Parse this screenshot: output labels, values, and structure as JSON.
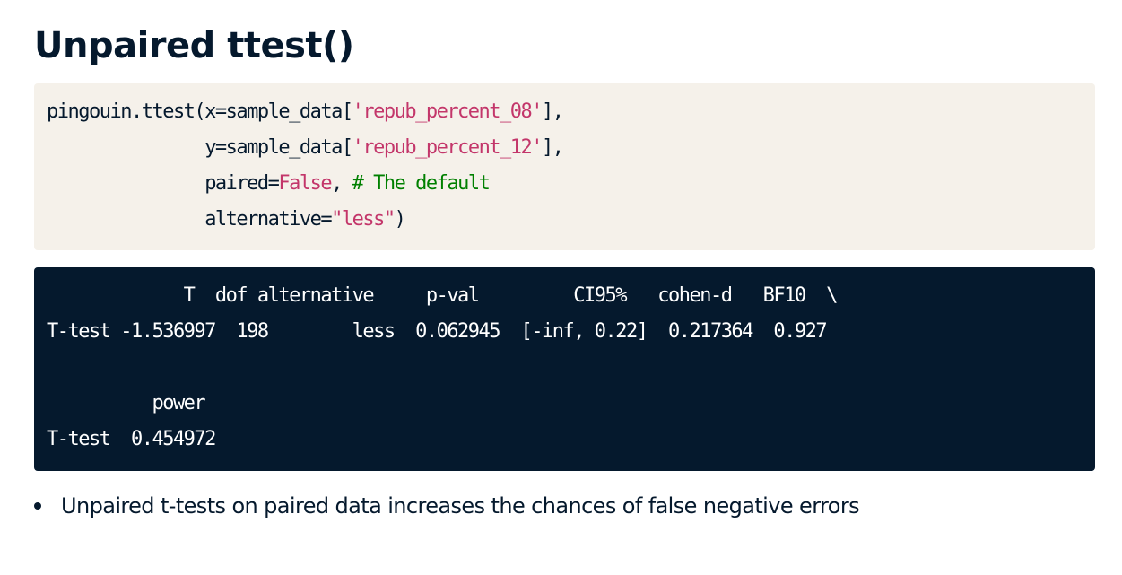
{
  "title": "Unpaired ttest()",
  "code": {
    "line1_fn": "pingouin.ttest(x=sample_data[",
    "line1_str": "'repub_percent_08'",
    "line1_end": "],",
    "line2_indent": "               ",
    "line2_fn": "y=sample_data[",
    "line2_str": "'repub_percent_12'",
    "line2_end": "],",
    "line3_indent": "               ",
    "line3_arg": "paired=",
    "line3_kw": "False",
    "line3_sep": ", ",
    "line3_comment": "# The default",
    "line4_indent": "               ",
    "line4_arg": "alternative=",
    "line4_str": "\"less\"",
    "line4_end": ")"
  },
  "output": {
    "header_row": "             T  dof alternative     p-val         CI95%   cohen-d   BF10  \\",
    "data_row": "T-test -1.536997  198        less  0.062945  [-inf, 0.22]  0.217364  0.927",
    "blank_row": " ",
    "header_row2": "          power",
    "data_row2": "T-test  0.454972"
  },
  "bullets": [
    "Unpaired t-tests on paired data increases the chances of false negative errors"
  ],
  "colors": {
    "title": "#05192d",
    "code_bg": "#f5f1ea",
    "output_bg": "#05192d",
    "string": "#c3366a",
    "comment": "#008000"
  }
}
